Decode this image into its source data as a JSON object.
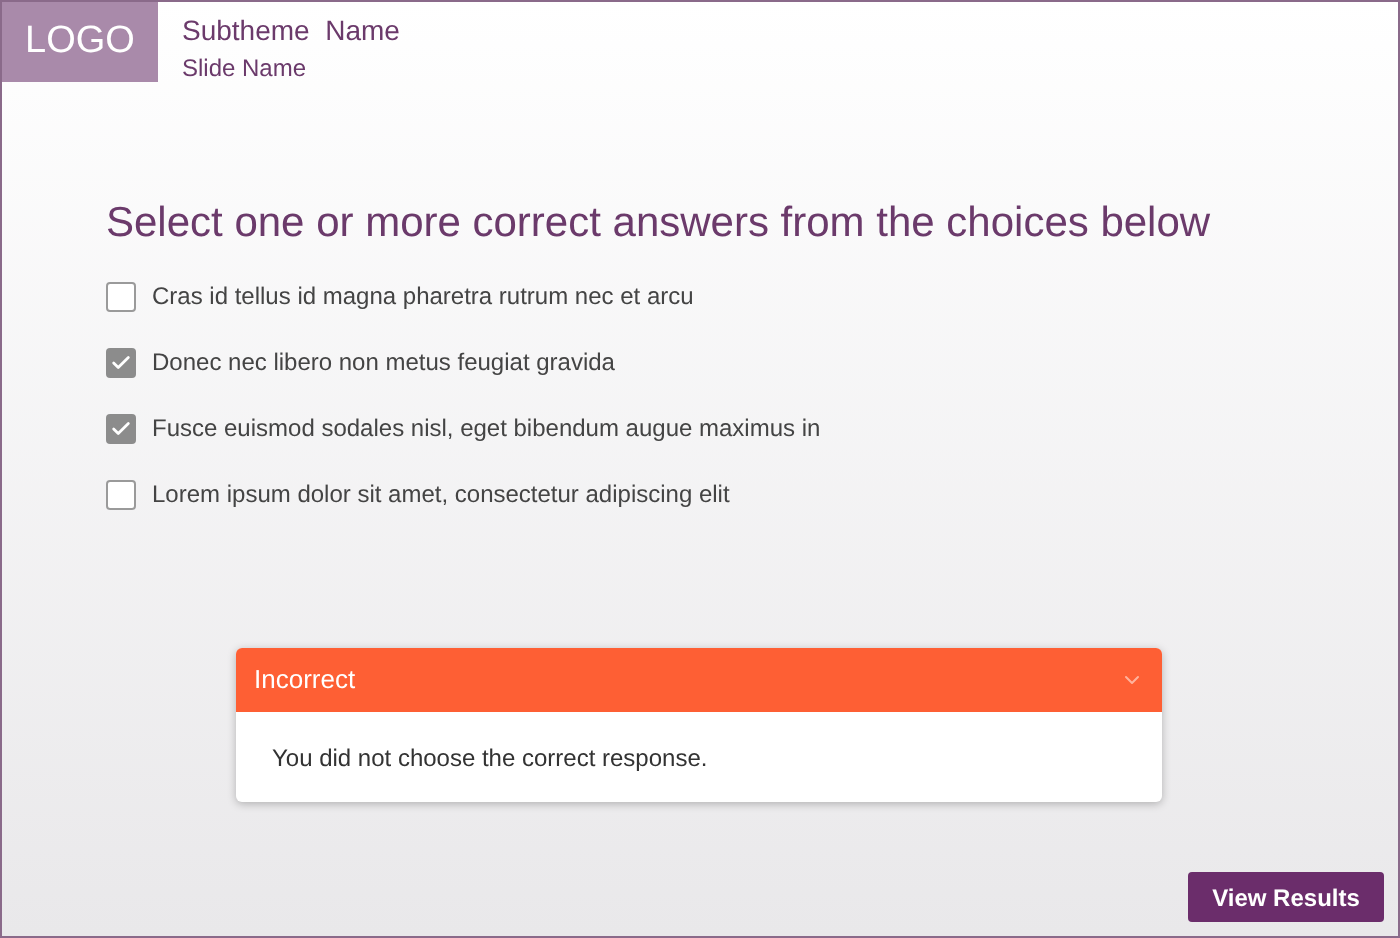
{
  "header": {
    "logo": "LOGO",
    "subtheme": "Subtheme  Name",
    "slide": "Slide Name"
  },
  "question": "Select one or more correct answers from the choices below",
  "choices": [
    {
      "label": "Cras id tellus id magna pharetra rutrum nec et arcu",
      "checked": false
    },
    {
      "label": "Donec nec libero non metus feugiat gravida",
      "checked": true
    },
    {
      "label": "Fusce euismod sodales nisl, eget bibendum augue maximus in",
      "checked": true
    },
    {
      "label": "Lorem ipsum dolor sit amet, consectetur adipiscing elit",
      "checked": false
    }
  ],
  "feedback": {
    "title": "Incorrect",
    "expanded": true,
    "message": "You did not choose the correct response."
  },
  "button": "View Results"
}
